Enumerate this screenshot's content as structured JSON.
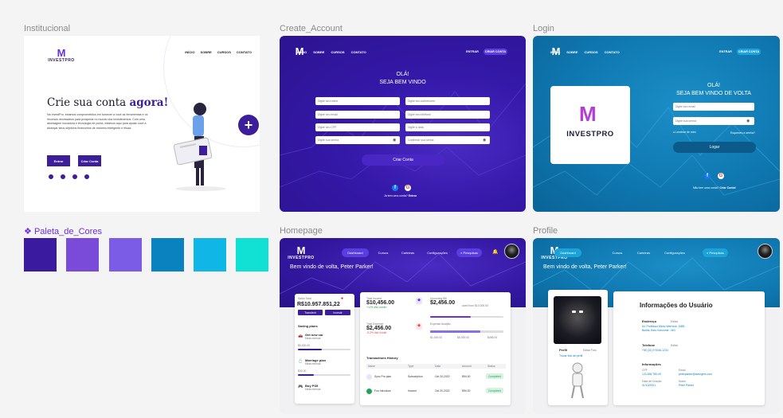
{
  "labels": {
    "institucional": "Institucional",
    "create": "Create_Account",
    "login": "Login",
    "palette": "Paleta_de_Cores",
    "home": "Homepage",
    "profile": "Profile"
  },
  "brand": {
    "word": "INVESTPRO",
    "mark": "M"
  },
  "colors": {
    "primary": "#3d1e9a",
    "palette_label": "#6b2ee0",
    "palette": [
      "#3a1a9e",
      "#7a4ad9",
      "#7b5ce6",
      "#0a82bf",
      "#10b6e6",
      "#11e0d4"
    ]
  },
  "institucional": {
    "nav": [
      "INÍCIO",
      "SOBRE",
      "CURSOS",
      "CONTATO"
    ],
    "title_plain": "Crie sua conta",
    "title_accent": "agora!",
    "text": "Na InvestPro, estamos comprometidos em fornecer a você as ferramentas e os recursos necessários para prosperar no mundo dos investimentos. Com uma abordagem inovadora e tecnologia de ponta, estamos aqui para ajudar você a alcançar seus objetivos financeiros de maneira inteligente e eficaz.",
    "btn_enter": "Entrar",
    "btn_create": "Criar Conta"
  },
  "create": {
    "nav": [
      "INÍCIO",
      "SOBRE",
      "CURSOS",
      "CONTATO"
    ],
    "enter": "ENTRAR",
    "create_btn": "CRIAR CONTA",
    "hello": "OLÁ!",
    "welcome": "SEJA BEM VINDO",
    "fields": [
      "Digite seu nome",
      "Digite seu sobrenome",
      "Digite seu email",
      "Digite seu telefone",
      "Digite seu CPF",
      "Digite a data",
      "Digite sua senha",
      "Confirmar sua senha"
    ],
    "submit": "Criar Conta",
    "footer_a": "Já tem uma conta?",
    "footer_b": "Entrar"
  },
  "login": {
    "nav": [
      "INÍCIO",
      "SOBRE",
      "CURSOS",
      "CONTATO"
    ],
    "enter": "ENTRAR",
    "create_btn": "CRIAR CONTA",
    "hello": "OLÁ!",
    "welcome": "SEJA BEM VINDO DE VOLTA",
    "email_ph": "Digite seu email",
    "pass_ph": "Digite sua senha",
    "remember": "Lembrar de mim",
    "forgot": "Esqueceu a senha?",
    "submit": "Logar",
    "footer_a": "Não tem uma conta?",
    "footer_b": "Criar Conta!"
  },
  "home": {
    "nav": [
      "Dashboard",
      "Cursos",
      "Carteiras",
      "Configurações",
      "Pesquisas"
    ],
    "welcome": "Bem vindo de volta, Peter Parker!",
    "balance_label": "Saldo Total",
    "balance": "R$10.957.851,22",
    "btn_transfer": "Transferir",
    "btn_invest": "Investir",
    "saving_title": "Saving plans",
    "plans": [
      {
        "name": "Get new car",
        "sub": "Meta mensal",
        "value": "$5,000.00",
        "target": "$12,000.00",
        "pct": 0.45
      },
      {
        "name": "Marriage plan",
        "sub": "Meta mensal",
        "value": "$30.00",
        "target": "$100.00",
        "pct": 0.3
      },
      {
        "name": "Buy PS5",
        "sub": "Meta mensal",
        "value": "",
        "target": "",
        "pct": 0.2
      }
    ],
    "stats": [
      {
        "label": "Total Income",
        "value": "$10,456.00",
        "note": "+12% this month"
      },
      {
        "label": "Upcoming Bill",
        "value": "$2,456.00",
        "note": "used from $10,000.00"
      },
      {
        "label": "Total Expense",
        "value": "$2,456.00",
        "note": "-5.2% this month"
      },
      {
        "label": "Expense Analytic",
        "value": "",
        "note": ""
      }
    ],
    "analytic": [
      "$1,000.00",
      "$5,000.00",
      "$456.00"
    ],
    "history_title": "Transactions History",
    "history_cols": [
      "Name",
      "Type",
      "Date",
      "Amount",
      "Status"
    ],
    "history": [
      {
        "name": "Sync Pro plan",
        "type": "Subscription",
        "date": "Oct 20,2022",
        "amount": "$94.00",
        "status": "Completed"
      },
      {
        "name": "Fun Introduce",
        "type": "Income",
        "date": "Oct 20,2022",
        "amount": "$94.00",
        "status": "Completed"
      }
    ]
  },
  "profile": {
    "nav": [
      "Dashboard",
      "Cursos",
      "Carteiras",
      "Configurações",
      "Pesquisas"
    ],
    "welcome": "Bem vindo de volta, Peter Parker!",
    "profile_label": "Perfil",
    "edit": "Editar Foto",
    "change": "Trocar foto de perfil",
    "info_title": "Informações do Usuário",
    "address_label": "Endereço",
    "edit_small": "Editar",
    "address": "Av. Professor Mário Werneck, 1685 - Buritis, Belo Horizonte - MG",
    "phone_label": "Telefone",
    "phone": "+55 (31) 9 9246-1234",
    "more_label": "Informações",
    "cpf_label": "CPF",
    "cpf": "123.456.789-00",
    "email_label": "Email",
    "email": "peterparker@avengers.com",
    "birth_label": "Data de Criação",
    "birth": "01/10/2001",
    "name_label": "Nome",
    "name": "Peter Parker"
  }
}
